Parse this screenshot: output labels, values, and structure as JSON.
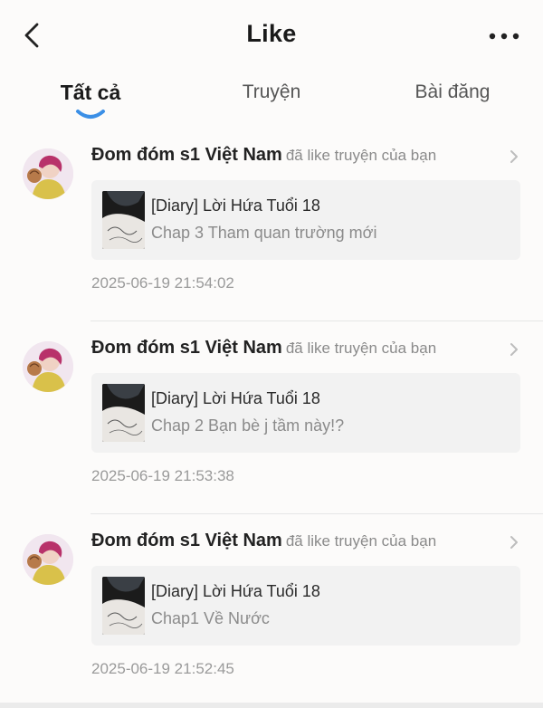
{
  "header": {
    "title": "Like",
    "back_icon": "chevron-left-icon",
    "more_icon": "more-horizontal-icon"
  },
  "tabs": [
    {
      "label": "Tất cả",
      "active": true
    },
    {
      "label": "Truyện",
      "active": false
    },
    {
      "label": "Bài đăng",
      "active": false
    }
  ],
  "accent_color": "#3b8fe6",
  "items": [
    {
      "actor": "Đom đóm s1 Việt Nam",
      "action": "đã like truyện của bạn",
      "story": "[Diary] Lời Hứa Tuổi 18",
      "chapter": "Chap 3 Tham quan trường mới",
      "time": "2025-06-19 21:54:02"
    },
    {
      "actor": "Đom đóm s1 Việt Nam",
      "action": "đã like truyện của bạn",
      "story": "[Diary] Lời Hứa Tuổi 18",
      "chapter": "Chap 2 Bạn bè j tầm này!?",
      "time": "2025-06-19 21:53:38"
    },
    {
      "actor": "Đom đóm s1 Việt Nam",
      "action": "đã like truyện của bạn",
      "story": "[Diary] Lời Hứa Tuổi 18",
      "chapter": "Chap1 Về Nước",
      "time": "2025-06-19 21:52:45"
    }
  ]
}
